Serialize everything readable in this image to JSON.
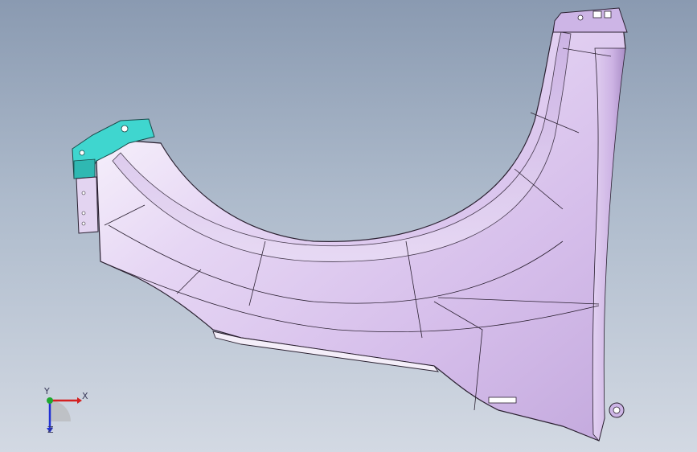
{
  "viewport": {
    "background_top": "#8a9ab1",
    "background_bottom": "#d3d9e3"
  },
  "model": {
    "part_color": "#d9c3ee",
    "part_highlight": "#f6f0fb",
    "part_shadow": "#b9a2d4",
    "bracket_color": "#3fd6cf",
    "edge_color": "#2a2030"
  },
  "triad": {
    "x_label": "X",
    "y_label": "Y",
    "z_label": "Z",
    "x_color": "#d42020",
    "y_color": "#1fa830",
    "z_color": "#2030d4"
  }
}
